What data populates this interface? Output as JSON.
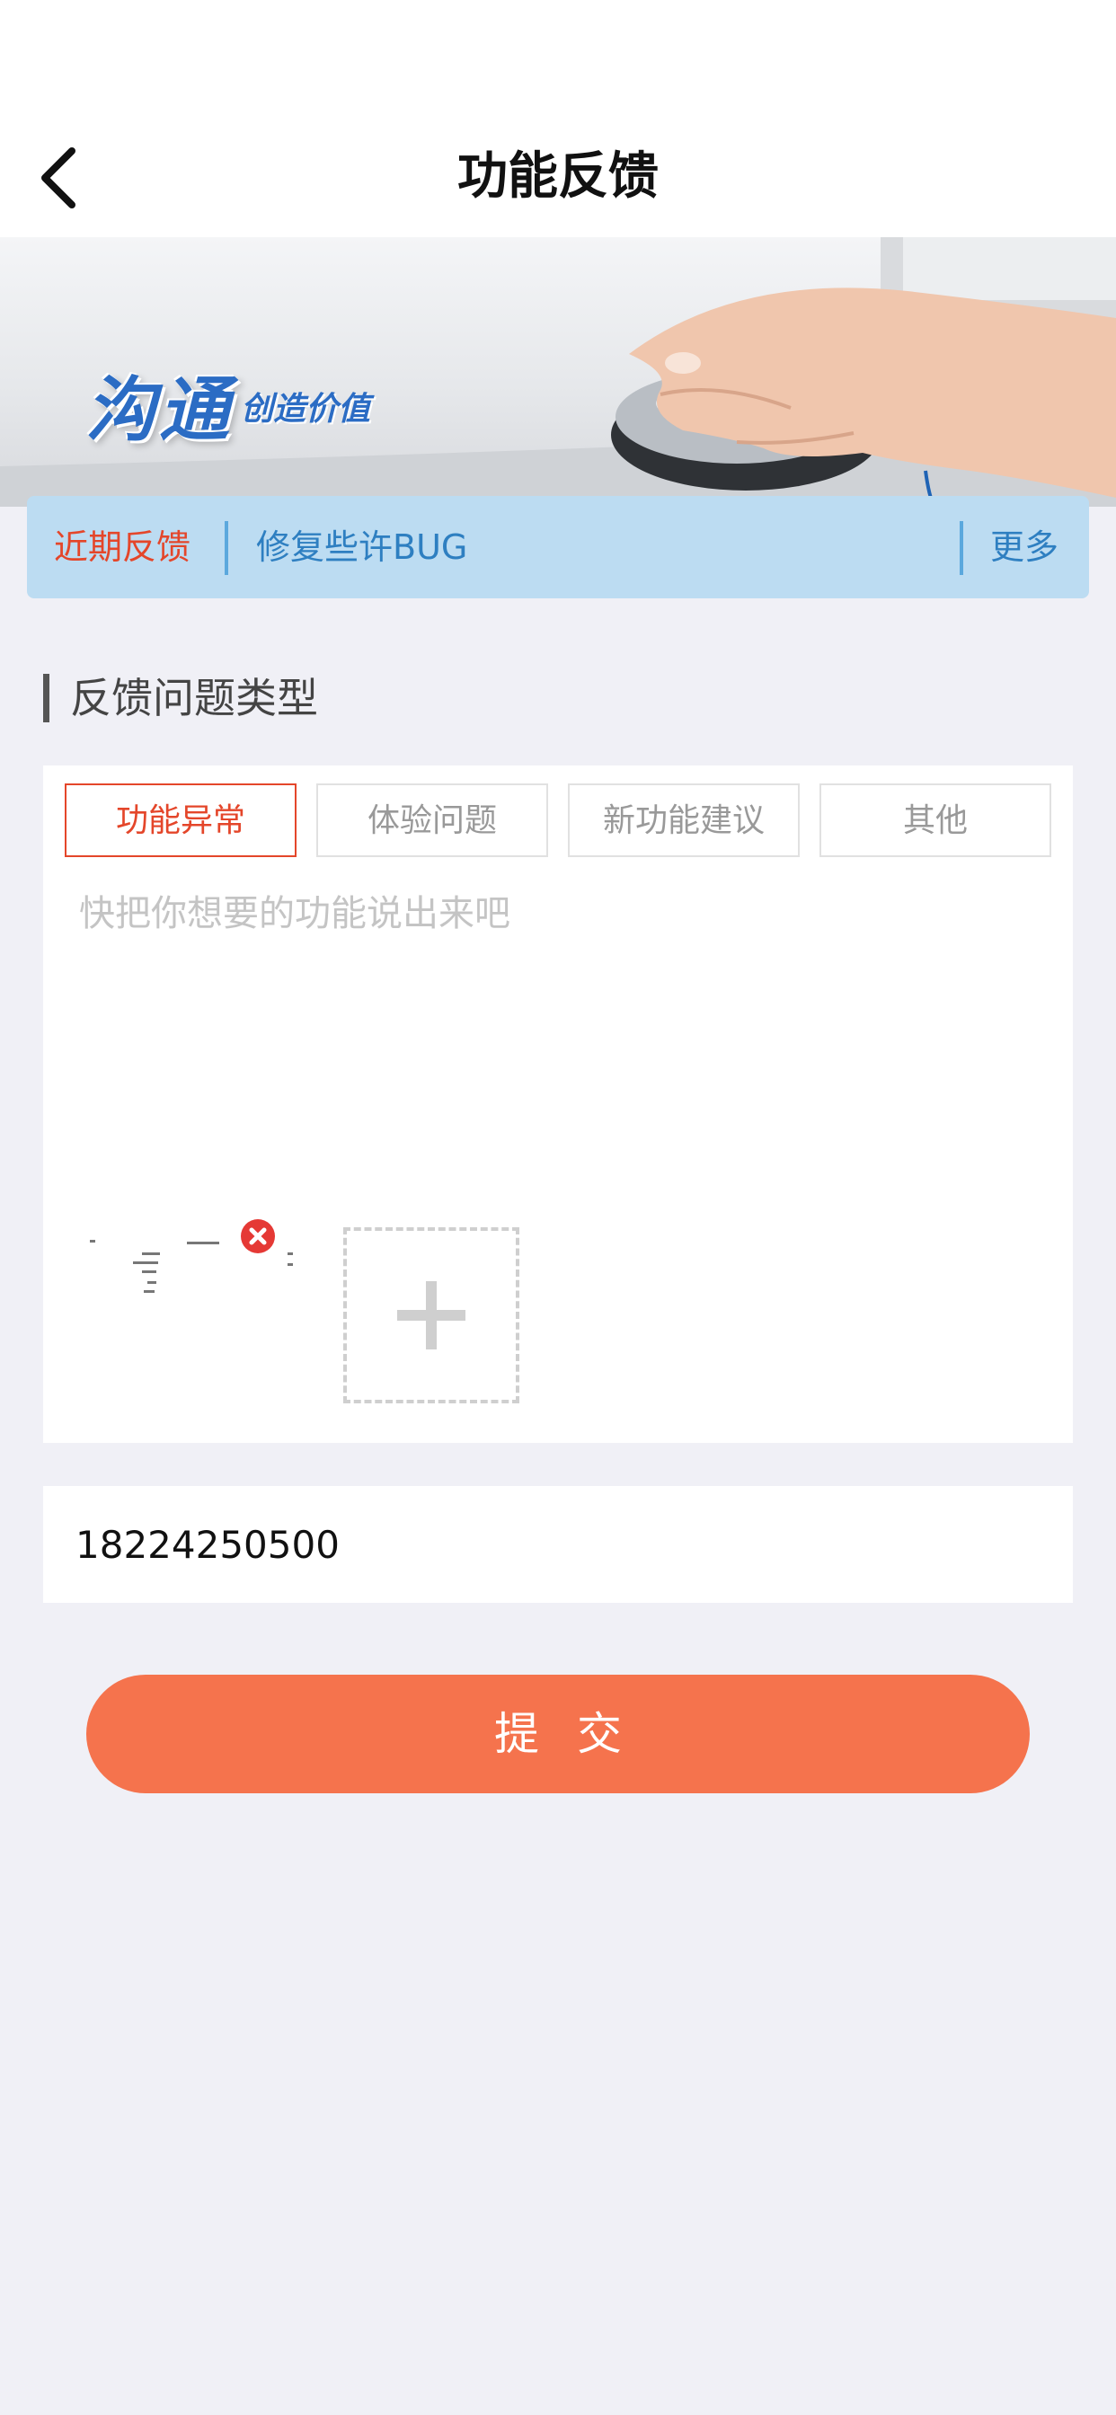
{
  "header": {
    "title": "功能反馈",
    "back_icon": "chevron-left-icon"
  },
  "banner": {
    "logo_text": "沟通",
    "slogan": "创造价值"
  },
  "notice": {
    "label": "近期反馈",
    "text": "修复些许BUG",
    "more": "更多"
  },
  "section": {
    "title": "反馈问题类型"
  },
  "tabs": [
    {
      "label": "功能异常",
      "active": true
    },
    {
      "label": "体验问题",
      "active": false
    },
    {
      "label": "新功能建议",
      "active": false
    },
    {
      "label": "其他",
      "active": false
    }
  ],
  "feedback": {
    "placeholder": "快把你想要的功能说出来吧",
    "value": ""
  },
  "attachments": {
    "delete_icon": "close-icon",
    "add_icon": "plus-icon"
  },
  "contact": {
    "value": "18224250500"
  },
  "submit": {
    "label": "提交"
  },
  "colors": {
    "accent": "#f5734d",
    "active_tab": "#e4462a",
    "notice_bg": "#bcdcf2",
    "notice_text": "#2e7fc1"
  }
}
